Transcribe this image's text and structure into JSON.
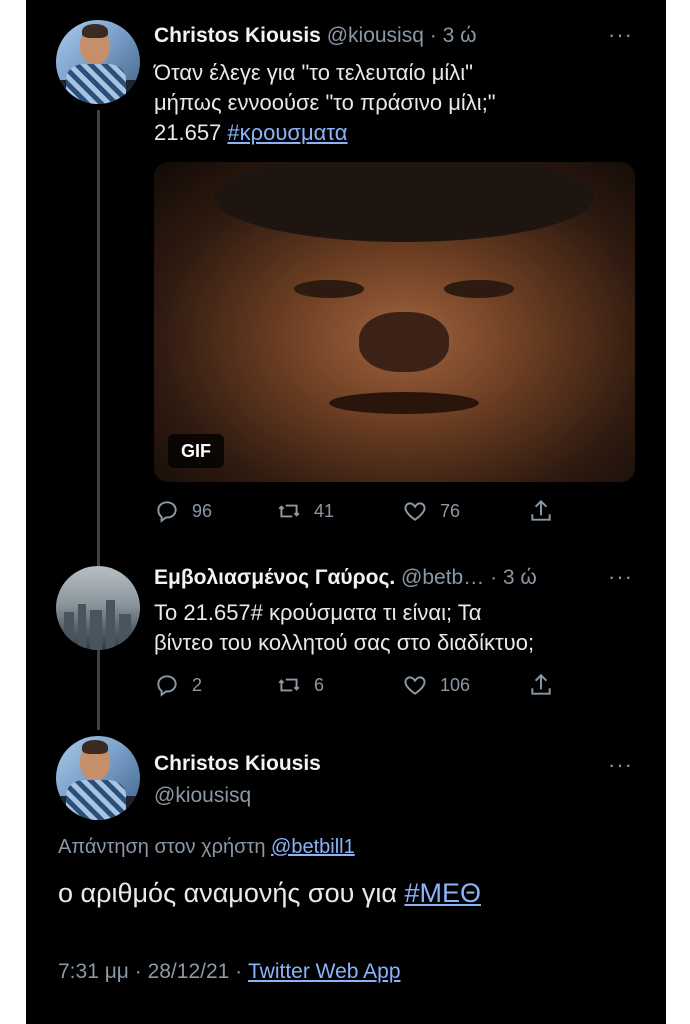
{
  "tweet1": {
    "name": "Christos Kiousis",
    "handle": "@kiousisq",
    "time": "· 3 ώ",
    "line1": "Όταν έλεγε για \"το τελευταίο μίλι\"",
    "line2": "μήπως εννοούσε \"το πράσινο μίλι;\"",
    "line3_text": "21.657 ",
    "line3_hashtag": "#κρουσματα",
    "media_badge": "GIF",
    "replies": "96",
    "retweets": "41",
    "likes": "76"
  },
  "tweet2": {
    "name": "Εμβολιασμένος Γαύρος.",
    "handle": "@betb…",
    "time": "· 3 ώ",
    "line1": "Το 21.657# κρούσματα τι είναι; Τα",
    "line2": "βίντεο του κολλητού σας στο διαδίκτυο;",
    "replies": "2",
    "retweets": "6",
    "likes": "106"
  },
  "tweet3": {
    "name": "Christos Kiousis",
    "handle": "@kiousisq",
    "reply_prefix": "Απάντηση στον χρήστη ",
    "reply_handle": "@betbill1",
    "text": "ο αριθμός αναμονής σου για ",
    "hashtag": "#ΜΕΘ",
    "timestamp": "7:31 μμ · 28/12/21 · ",
    "source": "Twitter Web App"
  },
  "icons": {
    "more": "···",
    "reply": "reply-icon",
    "retweet": "retweet-icon",
    "like": "heart-icon",
    "share": "share-icon"
  },
  "colors": {
    "background": "#000000",
    "link": "#8ab4f8",
    "muted": "#8b98a5",
    "text": "#e7e9ea"
  }
}
